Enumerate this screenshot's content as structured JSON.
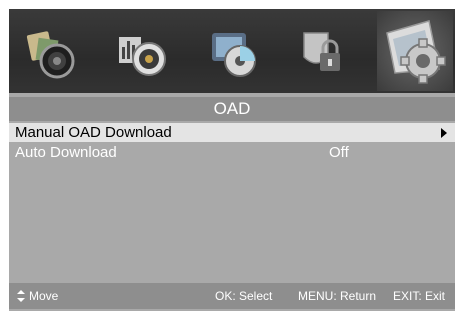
{
  "menu_tabs": [
    {
      "icon": "picture-icon"
    },
    {
      "icon": "sound-icon"
    },
    {
      "icon": "channel-icon"
    },
    {
      "icon": "lock-icon"
    },
    {
      "icon": "setup-gear-icon",
      "selected": true
    }
  ],
  "panel": {
    "title": "OAD",
    "items": [
      {
        "label": "Manual OAD Download",
        "value": "",
        "selected": true
      },
      {
        "label": "Auto Download",
        "value": "Off",
        "selected": false
      }
    ]
  },
  "footer": {
    "move": "Move",
    "select": "OK: Select",
    "menu": "MENU: Return",
    "exit": "EXIT: Exit"
  },
  "colors": {
    "panel_bg": "#a9a9a9",
    "title_bar": "#8e8e8e",
    "highlight_row": "#e4e4e4",
    "icon_bar": "#2e2e2e"
  }
}
